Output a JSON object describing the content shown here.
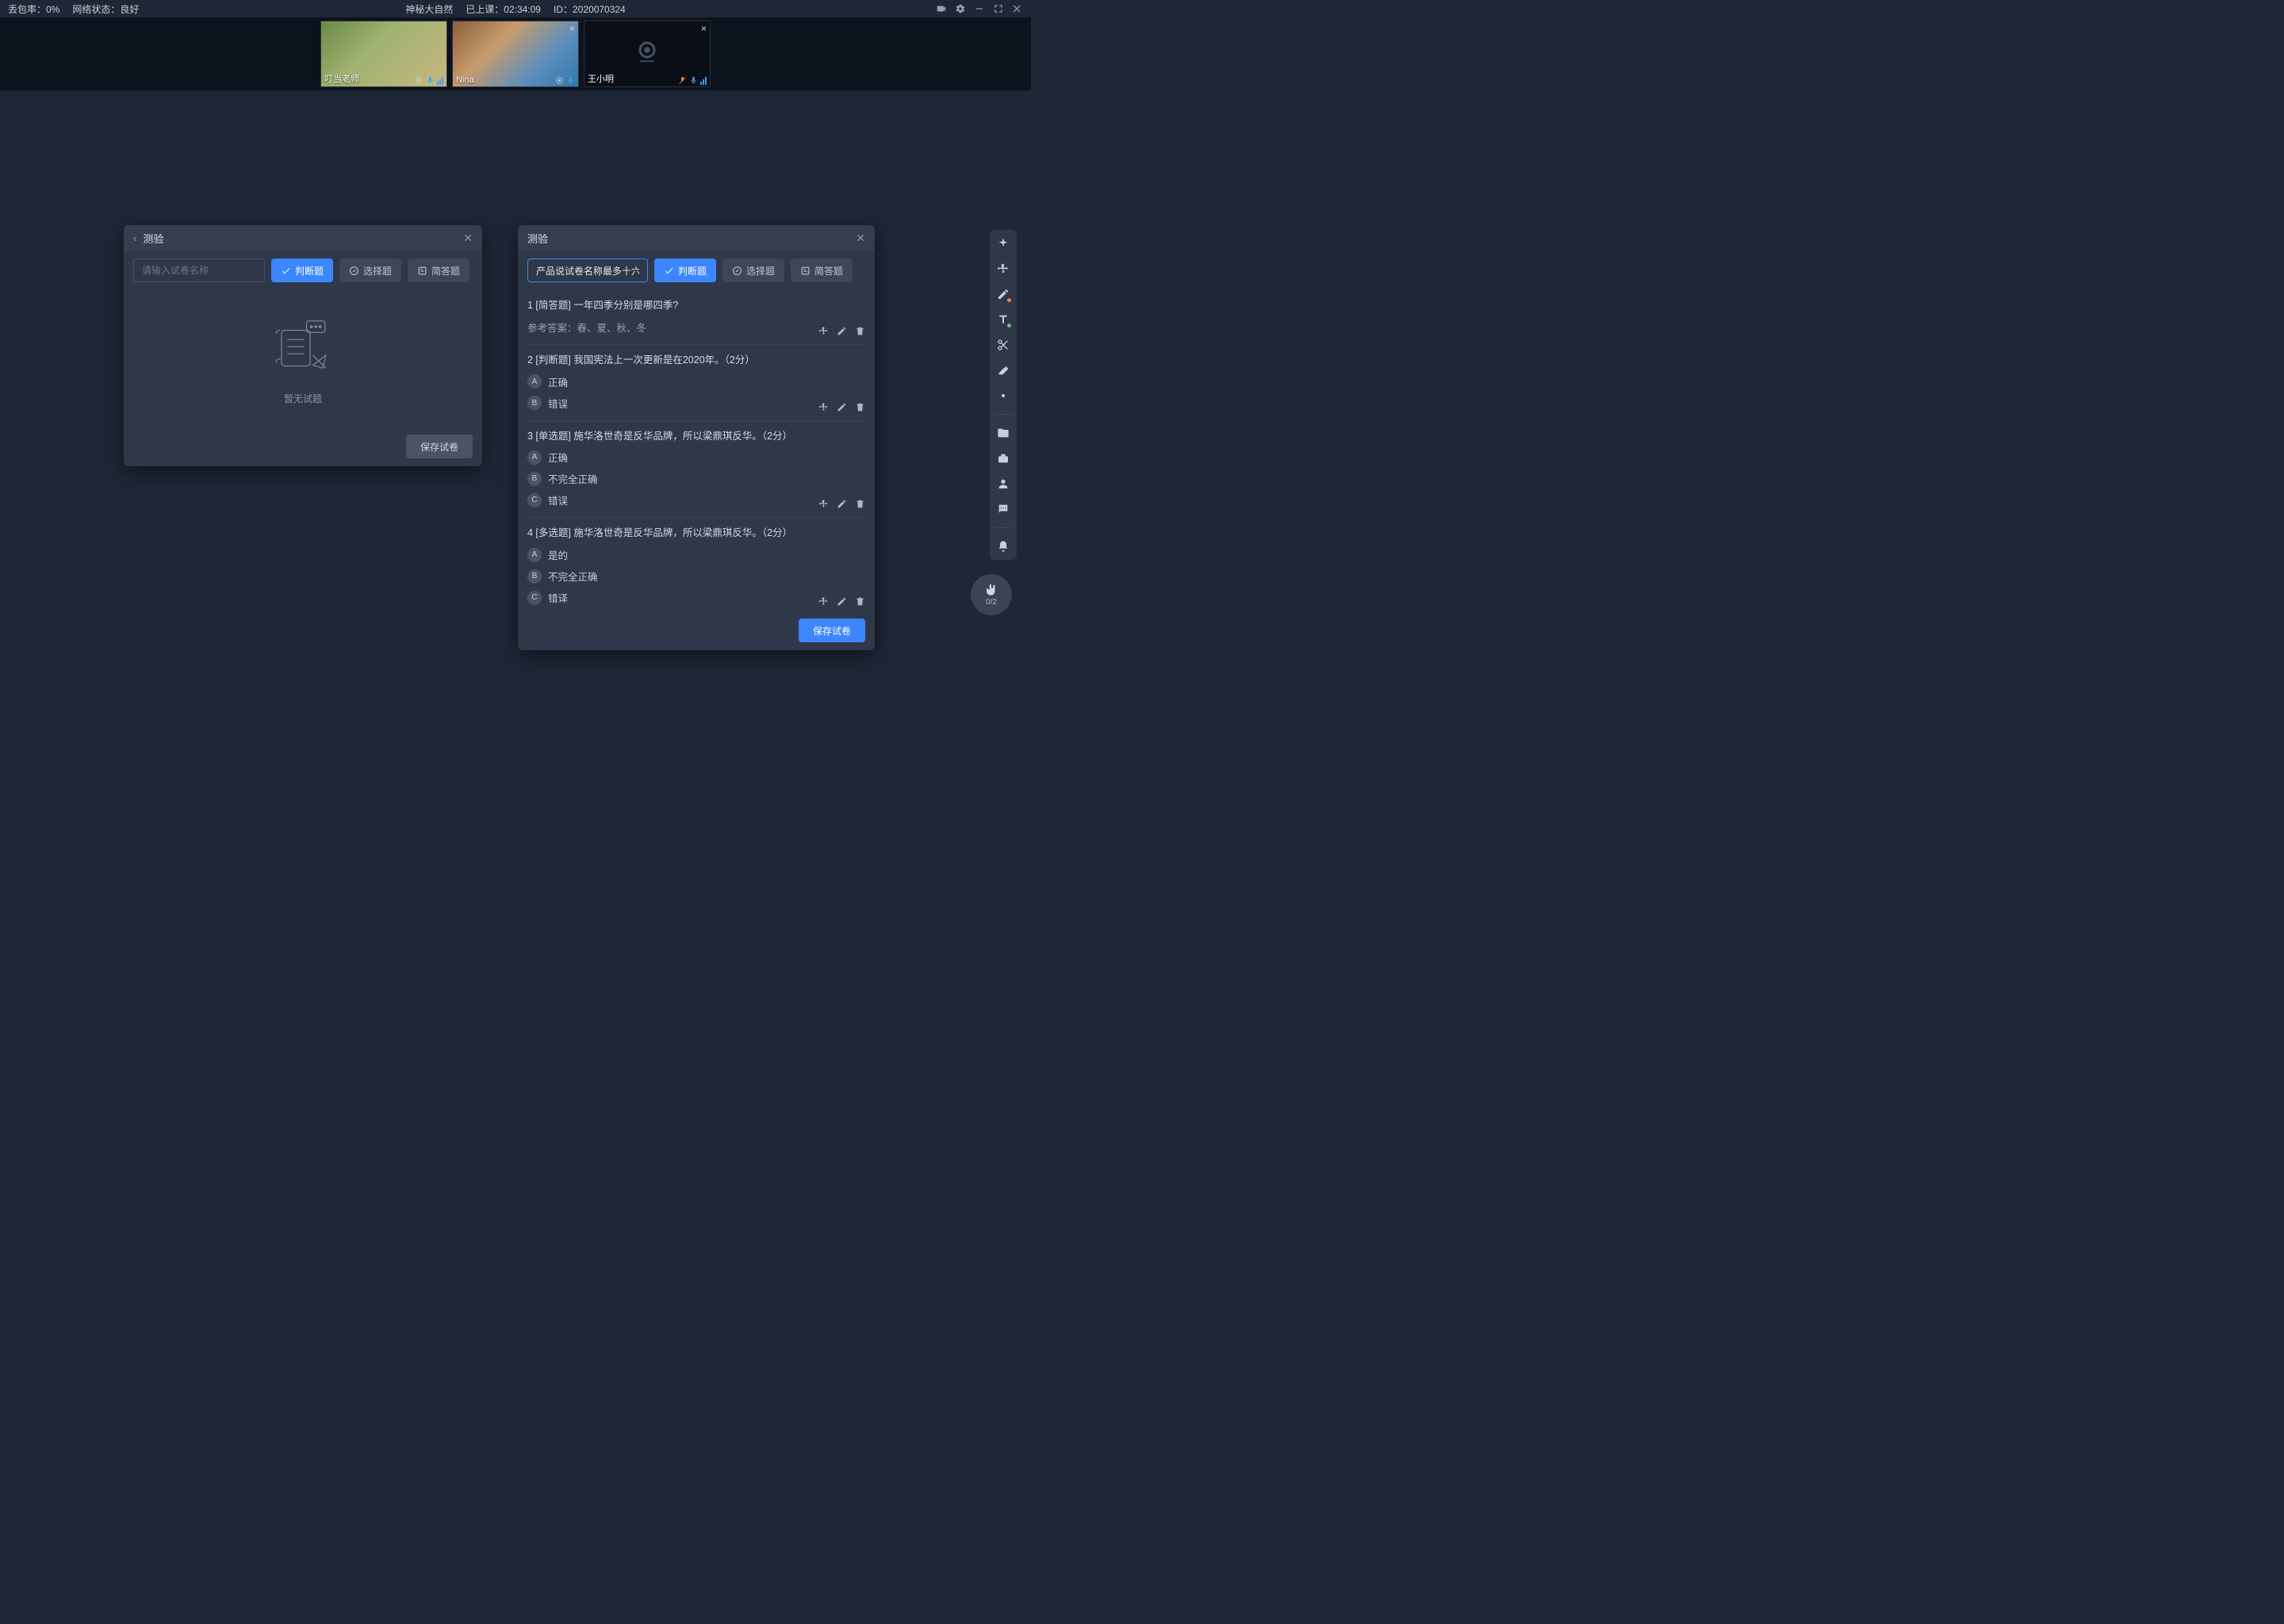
{
  "status": {
    "packet_loss_label": "丢包率：0%",
    "network_label": "网络状态：良好",
    "course_title": "神秘大自然",
    "elapsed": "已上课：02:34:09",
    "id": "ID：2020070324"
  },
  "videos": [
    {
      "name": "叮当老师",
      "has_close": false
    },
    {
      "name": "Nina",
      "has_close": true
    },
    {
      "name": "王小明",
      "has_close": true
    }
  ],
  "panel_title": "测验",
  "left_panel": {
    "input_placeholder": "请输入试卷名称",
    "empty_text": "暂无试题",
    "save_label": "保存试卷"
  },
  "right_panel": {
    "input_value": "产品说试卷名称最多十六个字",
    "save_label": "保存试卷"
  },
  "type_buttons": {
    "judge": "判断题",
    "choose": "选择题",
    "short": "简答题"
  },
  "questions": [
    {
      "title": "1 [简答题] 一年四季分别是哪四季?",
      "answer_line": "参考答案：春、夏、秋、冬",
      "options": []
    },
    {
      "title": "2 [判断题] 我国宪法上一次更新是在2020年。（2分）",
      "options": [
        {
          "letter": "A",
          "text": "正确"
        },
        {
          "letter": "B",
          "text": "错误"
        }
      ]
    },
    {
      "title": "3 [单选题] 施华洛世奇是反华品牌，所以梁鼎琪反华。（2分）",
      "options": [
        {
          "letter": "A",
          "text": "正确"
        },
        {
          "letter": "B",
          "text": "不完全正确"
        },
        {
          "letter": "C",
          "text": "错误"
        }
      ]
    },
    {
      "title": "4 [多选题] 施华洛世奇是反华品牌，所以梁鼎琪反华。（2分）",
      "options": [
        {
          "letter": "A",
          "text": "是的"
        },
        {
          "letter": "B",
          "text": "不完全正确"
        },
        {
          "letter": "C",
          "text": "错译"
        }
      ]
    }
  ],
  "hand": {
    "count": "0/2"
  }
}
